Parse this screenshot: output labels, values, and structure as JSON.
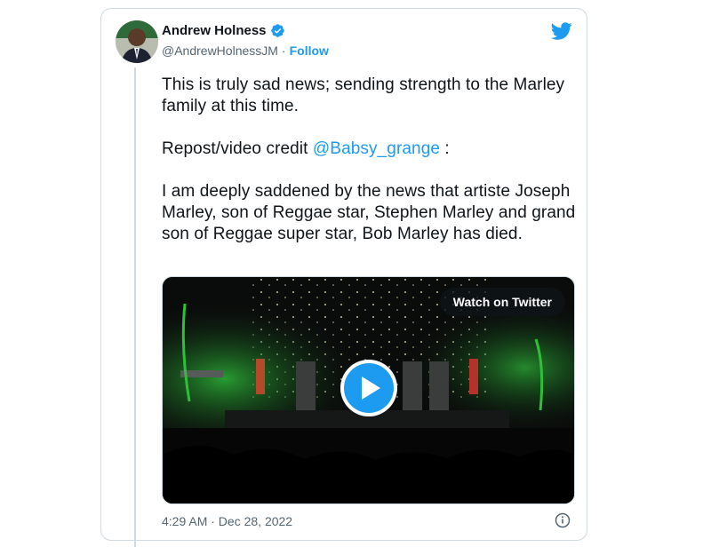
{
  "author": {
    "name": "Andrew Holness",
    "handle": "@AndrewHolnessJM",
    "separator": "·",
    "follow_label": "Follow",
    "verified": true
  },
  "icons": {
    "verified": "verified-badge-icon",
    "twitter": "twitter-bird-icon",
    "play": "play-icon",
    "info": "info-icon"
  },
  "colors": {
    "accent": "#1d9bf0",
    "text": "#0f1419",
    "muted": "#536471",
    "border": "#cfd9de"
  },
  "tweet": {
    "para1": "This is truly sad news; sending strength to the Marley family at this time.",
    "para2_prefix": "Repost/video credit ",
    "para2_mention": "@Babsy_grange",
    "para2_suffix": " :",
    "para3": "I am deeply saddened by the news that artiste Joseph Marley, son of Reggae star, Stephen Marley and grand son of Reggae super star, Bob Marley has died."
  },
  "media": {
    "watch_label": "Watch on Twitter"
  },
  "footer": {
    "timestamp": "4:29 AM · Dec 28, 2022"
  }
}
